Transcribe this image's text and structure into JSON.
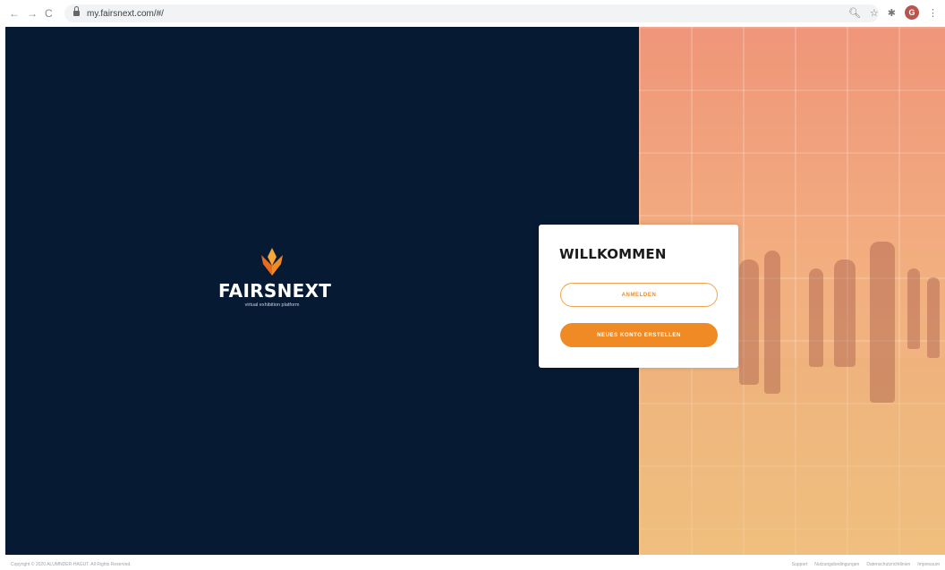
{
  "browser": {
    "url": "my.fairsnext.com/#/",
    "back_icon": "←",
    "forward_icon": "→",
    "reload_icon": "C",
    "zoom_icon": "🔍︎",
    "star_icon": "☆",
    "extension_icon": "✱",
    "profile_initial": "G",
    "menu_icon": "⋮"
  },
  "brand": {
    "name": "FAIRSNEXT",
    "tagline": "virtual exhibition platform",
    "accent_color": "#f08a24",
    "background_color": "#061a33"
  },
  "welcome_card": {
    "title": "WILLKOMMEN",
    "login_label": "ANMELDEN",
    "register_label": "NEUES KONTO ERSTELLEN"
  },
  "footer": {
    "copyright": "Copyright © 2020 ALUMNDER-HAGUT. All Rights Reserved.",
    "links": [
      "Support",
      "Nutzungsbedingungen",
      "Datenschutzrichtlinien",
      "Impressum"
    ]
  }
}
